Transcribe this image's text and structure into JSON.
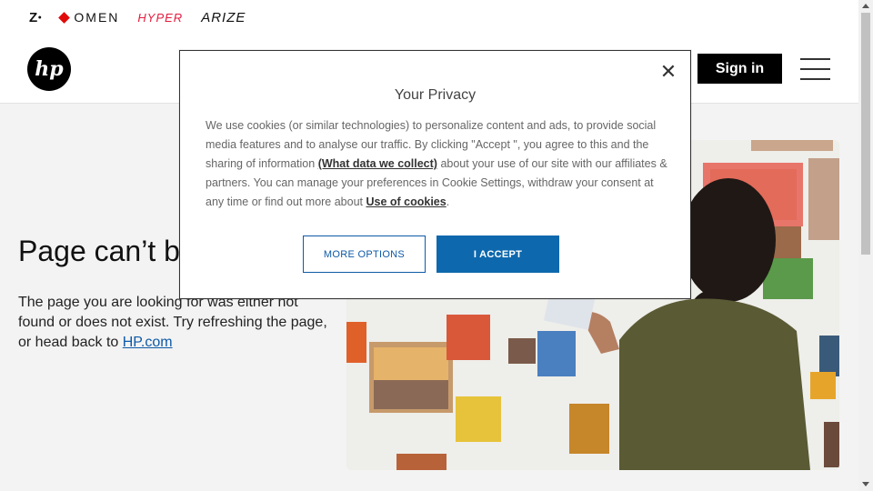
{
  "brands": {
    "z": "Z",
    "omen": "OMEN",
    "hyperx": "HYPER",
    "arize": "ARIZE"
  },
  "header": {
    "logo_text": "hp",
    "signin_label": "Sign in"
  },
  "main": {
    "title": "Page can’t be",
    "body_prefix": "The page you are looking for was either not found or does not exist. Try refreshing the page, or head back to ",
    "body_link": "HP.com"
  },
  "dialog": {
    "title": "Your Privacy",
    "text_1": "We use cookies (or similar technologies) to personalize content and ads, to provide social media features and to analyse our traffic. By clicking \"Accept \", you agree to this and the sharing of information ",
    "link_data": "(What data we collect)",
    "text_2": " about your use of our site with our affiliates & partners. You can manage your preferences in Cookie Settings, withdraw your consent at any time or find out more about ",
    "link_cookies": "Use of cookies",
    "text_3": ".",
    "more_options_label": "MORE OPTIONS",
    "accept_label": "I ACCEPT",
    "close_symbol": "✕"
  },
  "colors": {
    "accent_blue": "#0e68ad",
    "link_blue": "#0e5aa7",
    "omen_red": "#e10a0a",
    "hyperx_red": "#e31c3d"
  }
}
